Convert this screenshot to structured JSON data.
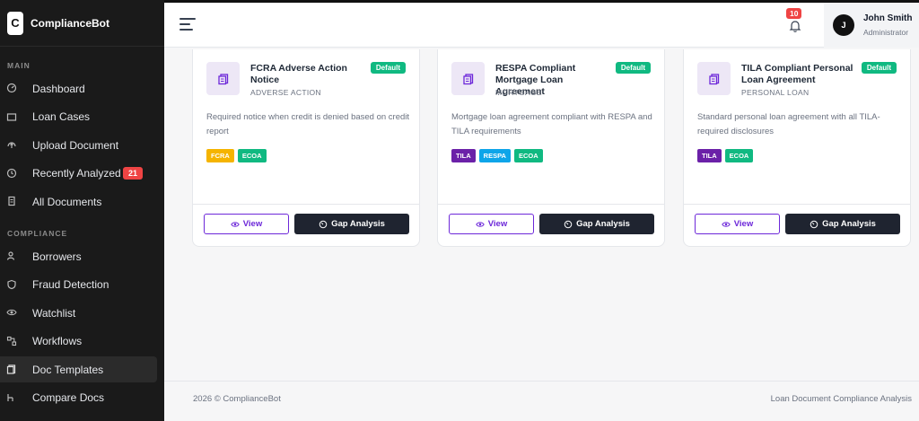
{
  "app": {
    "logo_letter": "C",
    "name": "ComplianceBot"
  },
  "sidebar": {
    "sections": [
      {
        "label": "MAIN",
        "items": [
          {
            "label": "Dashboard",
            "icon": "dashboard-icon"
          },
          {
            "label": "Loan Cases",
            "icon": "folder-icon"
          },
          {
            "label": "Upload Document",
            "icon": "upload-icon"
          },
          {
            "label": "Recently Analyzed",
            "icon": "history-icon",
            "badge": "21"
          },
          {
            "label": "All Documents",
            "icon": "documents-icon"
          }
        ]
      },
      {
        "label": "COMPLIANCE",
        "items": [
          {
            "label": "Borrowers",
            "icon": "users-icon"
          },
          {
            "label": "Fraud Detection",
            "icon": "shield-icon"
          },
          {
            "label": "Watchlist",
            "icon": "eye-icon"
          },
          {
            "label": "Workflows",
            "icon": "workflow-icon"
          },
          {
            "label": "Doc Templates",
            "icon": "template-icon",
            "active": true
          },
          {
            "label": "Compare Docs",
            "icon": "compare-icon"
          }
        ]
      }
    ]
  },
  "topbar": {
    "notifications_count": "10",
    "user": {
      "initial": "J",
      "name": "John Smith",
      "role": "Administrator"
    }
  },
  "templates": [
    {
      "title": "FCRA Adverse Action Notice",
      "category": "ADVERSE ACTION",
      "badge": "Default",
      "description": "Required notice when credit is denied based on credit report",
      "tags": [
        {
          "label": "FCRA",
          "color": "#f5b400"
        },
        {
          "label": "ECOA",
          "color": "#10b981"
        }
      ],
      "view_label": "View",
      "gap_label": "Gap Analysis"
    },
    {
      "title": "RESPA Compliant Mortgage Loan Agreement",
      "category": "MORTGAGE",
      "badge": "Default",
      "description": "Mortgage loan agreement compliant with RESPA and TILA requirements",
      "tags": [
        {
          "label": "TILA",
          "color": "#6b21a8"
        },
        {
          "label": "RESPA",
          "color": "#0ea5e9"
        },
        {
          "label": "ECOA",
          "color": "#10b981"
        }
      ],
      "view_label": "View",
      "gap_label": "Gap Analysis"
    },
    {
      "title": "TILA Compliant Personal Loan Agreement",
      "category": "PERSONAL LOAN",
      "badge": "Default",
      "description": "Standard personal loan agreement with all TILA-required disclosures",
      "tags": [
        {
          "label": "TILA",
          "color": "#6b21a8"
        },
        {
          "label": "ECOA",
          "color": "#10b981"
        }
      ],
      "view_label": "View",
      "gap_label": "Gap Analysis"
    }
  ],
  "footer": {
    "left": "2026 © ComplianceBot",
    "right": "Loan Document Compliance Analysis"
  },
  "colors": {
    "accent": "#6d28d9",
    "sidebar_bg": "#1a1a1a",
    "default_badge": "#10b981",
    "alert": "#ef4444"
  }
}
